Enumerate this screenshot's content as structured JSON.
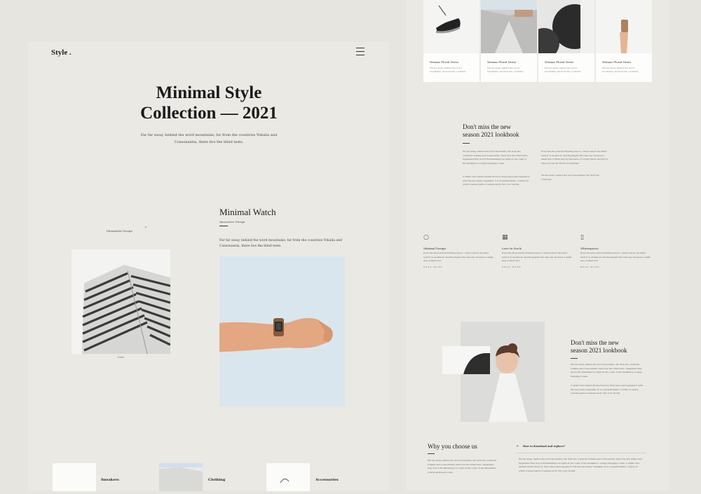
{
  "left_page": {
    "logo": "Style .",
    "hero_title_line1": "Minimal Style",
    "hero_title_line2": "Collection — 2021",
    "hero_text": "Far far away, behind the word mountains, far from the countries Vokalia and Consonantia, there live the blind texts.",
    "gallery_label": "Minimalist Design",
    "image_caption": "texts",
    "watch": {
      "title": "Minimal Watch",
      "subtitle": "Innovative Design",
      "text": "Far far away, behind the word mountains, far from the countries Vokalia and Consonantia, there live the blind texts."
    },
    "categories": [
      {
        "label": "Sneakers"
      },
      {
        "label": "Clothing"
      },
      {
        "label": "Accessories"
      }
    ]
  },
  "right_page": {
    "products": [
      {
        "title": "Woman Floral Dress",
        "text": "Far far away, behind the word mountains, far from the countries"
      },
      {
        "title": "Woman Floral Dress",
        "text": "Far far away, behind the word mountains, far from the countries"
      },
      {
        "title": "Woman Floral Dress",
        "text": "Far far away, behind the word mountains, far from the countries"
      },
      {
        "title": "Woman Floral Dress",
        "text": "Far far away, behind the word mountains, far from the countries"
      }
    ],
    "lookbook": {
      "title_line1": "Don't miss the new",
      "title_line2": "season 2021 lookbook",
      "col1_p1": "Far far away, behind the word mountains, far from the countries Vokalia and Consonantia, there live the blind texts. Separated they live in Bookmarksgrove right at the coast of the Semantics, a large language ocean.",
      "col1_p2": "A small river named Duden flows by their place and supplies it with the necessary regelialia. It is a paradisematic country, in which roasted parts of sentences fly into your mouth.",
      "col2_p1": "Even the all-powerful Pointing has no control about the blind texts it is an almost unorthographic life One day however a small line of blind text by the name of Lorem Ipsum decided to leave for the far World of Grammar.",
      "col2_p2": "Far far away, behind the word mountains, far from the countries."
    },
    "features": [
      {
        "icon": "💬",
        "title": "Minimal Design",
        "text": "Even the all-powerful Pointing has no control about the blind texts it is an almost unorthographic life One day however a small line of blind text",
        "link": "READ MORE"
      },
      {
        "icon": "📅",
        "title": "Love In Stock",
        "text": "Even the all-powerful Pointing has no control about the blind texts it is an almost unorthographic life One day however a small line of blind text",
        "link": "READ MORE"
      },
      {
        "icon": "📄",
        "title": "Whitespaces",
        "text": "Even the all-powerful Pointing has no control about the blind texts it is an almost unorthographic life One day however a small line of blind text",
        "link": "READ MORE"
      }
    ],
    "lookbook2": {
      "title_line1": "Don't miss the new",
      "title_line2": "season 2021 lookbook",
      "p1": "Far far away, behind the word mountains, far from the countries Vokalia and Consonantia, there live the blind texts. Separated they live in Bookmarksgrove right at the coast of the Semantics, a large language ocean.",
      "p2": "A small river named Duden flows by their place and supplies it with the necessary regelialia. It is a paradisematic country, in which roasted parts of sentences fly into your mouth."
    },
    "why": {
      "title": "Why you choose us",
      "text": "Far far away, behind the word mountains, far from the countries Vokalia and Consonantia, there live the blind texts. Separated they live in Bookmarksgrove right at the coast of the Semantics, a large language ocean.",
      "faq_question": "How to download and replace?",
      "faq_answer": "Far far away, behind the word mountains, far from the countries Vokalia and Consonantia, there live the blind texts. Separated they live in Bookmarksgrove right at the coast of the Semantics, a large language ocean. A small river named Duden flows by their place and supplies it with the necessary regelialia. It is a paradisematic country, in which roasted parts of sentences fly into your mouth."
    }
  }
}
